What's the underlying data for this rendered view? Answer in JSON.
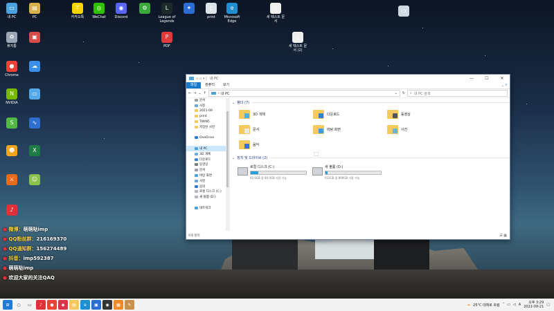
{
  "desktop_icons": [
    {
      "label": "내 PC",
      "color": "#4aa3df",
      "glyph": "▭"
    },
    {
      "label": "PC",
      "color": "#d8b24a",
      "glyph": "▤"
    },
    {
      "label": "카카오톡",
      "color": "#f7d300",
      "glyph": "T"
    },
    {
      "label": "WeChat",
      "color": "#2dc100",
      "glyph": "◎"
    },
    {
      "label": "Discord",
      "color": "#5865f2",
      "glyph": "◉"
    },
    {
      "label": "",
      "color": "#3aa83a",
      "glyph": "⚙"
    },
    {
      "label": "League of Legends",
      "color": "#1b2a2a",
      "glyph": "L"
    },
    {
      "label": "",
      "color": "#2a6ed4",
      "glyph": "✦"
    },
    {
      "label": "print",
      "color": "#dde3ea",
      "glyph": "▯"
    },
    {
      "label": "Microsoft Edge",
      "color": "#1f8fd0",
      "glyph": "e"
    },
    {
      "label": "새 텍스트 문서",
      "color": "#eeeeee",
      "glyph": "▯"
    },
    {
      "label": "",
      "color": "#cfd9e4",
      "glyph": "▭"
    },
    {
      "label": "휴지통",
      "color": "#9aa6b3",
      "glyph": "♻"
    },
    {
      "label": "",
      "color": "#d84b4b",
      "glyph": "▣"
    },
    {
      "label": "PDF",
      "color": "#e23a3a",
      "glyph": "P"
    },
    {
      "label": "새 텍스트 문서 (2)",
      "color": "#eeeeee",
      "glyph": "▯"
    },
    {
      "label": "Chrome",
      "color": "#ea4335",
      "glyph": "●"
    },
    {
      "label": "",
      "color": "#3b8fe6",
      "glyph": "☁"
    },
    {
      "label": "NVIDIA",
      "color": "#76b900",
      "glyph": "N"
    },
    {
      "label": "",
      "color": "#56a9e8",
      "glyph": "▭"
    },
    {
      "label": "",
      "color": "#52b848",
      "glyph": "S"
    },
    {
      "label": "",
      "color": "#2f6fd0",
      "glyph": "∿"
    },
    {
      "label": "",
      "color": "#f2a41c",
      "glyph": "☻"
    },
    {
      "label": "",
      "color": "#1d7b45",
      "glyph": "X"
    },
    {
      "label": "",
      "color": "#e86b1a",
      "glyph": "⚔"
    },
    {
      "label": "",
      "color": "#8bc34a",
      "glyph": "☺"
    },
    {
      "label": "",
      "color": "#e0303a",
      "glyph": "♪"
    }
  ],
  "explorer": {
    "title": "내 PC",
    "window_controls": [
      "—",
      "☐",
      "✕"
    ],
    "ribbon_tabs": [
      "파일",
      "컴퓨터",
      "보기"
    ],
    "address": "내 PC",
    "search_placeholder": "내 PC 검색",
    "nav_items": [
      {
        "label": "문서",
        "color": "#9aa0a6"
      },
      {
        "label": "사진",
        "color": "#6aa6d8"
      },
      {
        "label": "2021-09",
        "color": "#f4c95d"
      },
      {
        "label": "print",
        "color": "#f4c95d"
      },
      {
        "label": "TWIN5",
        "color": "#f4c95d"
      },
      {
        "label": "저장된 사진",
        "color": "#f4c95d"
      },
      {
        "label": "",
        "color": "transparent"
      },
      {
        "label": "OneDrive",
        "color": "#2a7bd4"
      },
      {
        "label": "",
        "color": "transparent"
      },
      {
        "label": "내 PC",
        "color": "#4aa3df",
        "selected": true
      },
      {
        "label": "3D 개체",
        "color": "#6ab0e4"
      },
      {
        "label": "다운로드",
        "color": "#3a86d6"
      },
      {
        "label": "동영상",
        "color": "#7a7a7a"
      },
      {
        "label": "문서",
        "color": "#9aa0a6"
      },
      {
        "label": "바탕 화면",
        "color": "#4aa3df"
      },
      {
        "label": "사진",
        "color": "#6aa6d8"
      },
      {
        "label": "음악",
        "color": "#3a7bd5"
      },
      {
        "label": "로컬 디스크 (C:)",
        "color": "#b0b6bc"
      },
      {
        "label": "새 볼륨 (D:)",
        "color": "#b0b6bc"
      },
      {
        "label": "",
        "color": "transparent"
      },
      {
        "label": "네트워크",
        "color": "#4aa3df"
      }
    ],
    "folders_heading": "폴더 (7)",
    "folders": [
      {
        "label": "3D 개체",
        "badge": "#4ab0e6"
      },
      {
        "label": "다운로드",
        "badge": "#2f7fd6"
      },
      {
        "label": "동영상",
        "badge": "#555555"
      },
      {
        "label": "문서",
        "badge": "#e8e8e8"
      },
      {
        "label": "바탕 화면",
        "badge": "#3a9ee0"
      },
      {
        "label": "사진",
        "badge": "#6fb0e0"
      },
      {
        "label": "음악",
        "badge": "#3a6fd5"
      }
    ],
    "drives_heading": "장치 및 드라이브 (2)",
    "drives": [
      {
        "label": "로컬 디스크 (C:)",
        "fill": 0.14,
        "detail": "93.0GB 중 80.0GB 사용 가능"
      },
      {
        "label": "새 볼륨 (D:)",
        "fill": 0.04,
        "detail": "931GB 중 899GB 사용 가능"
      }
    ],
    "status": "9개 항목"
  },
  "overlay": [
    {
      "key": "微博：",
      "value": "萌萌哒imp"
    },
    {
      "key": "QQ粉丝群：",
      "value": "216169370"
    },
    {
      "key": "QQ通知群：",
      "value": "156274489"
    },
    {
      "key": "抖音：",
      "value": "imp592387"
    },
    {
      "key": "",
      "value": "萌萌哒imp"
    },
    {
      "key": "",
      "value": "欢迎大家的关注QAQ"
    }
  ],
  "taskbar": {
    "weather": "25°C 대체로 흐림",
    "ime": "A",
    "time": "오후 3:29",
    "date": "2021-09-21",
    "icons": [
      {
        "name": "windows-start-icon",
        "color": "#1f7ad8",
        "glyph": "⊞"
      },
      {
        "name": "search-taskbar-icon",
        "color": "#f3f3f3",
        "glyph": "○"
      },
      {
        "name": "task-view-icon",
        "color": "#f3f3f3",
        "glyph": "▭"
      },
      {
        "name": "netease-music-icon",
        "color": "#e0303a",
        "glyph": "♪"
      },
      {
        "name": "chrome-taskbar-icon",
        "color": "#ea4335",
        "glyph": "●"
      },
      {
        "name": "app-taskbar-icon",
        "color": "#d8344a",
        "glyph": "◆"
      },
      {
        "name": "explorer-taskbar-icon",
        "color": "#f4c95d",
        "glyph": "▤"
      },
      {
        "name": "edge-taskbar-icon",
        "color": "#1f8fd0",
        "glyph": "e"
      },
      {
        "name": "store-taskbar-icon",
        "color": "#2a6ed4",
        "glyph": "▣"
      },
      {
        "name": "obs-taskbar-icon",
        "color": "#333333",
        "glyph": "◉"
      },
      {
        "name": "active-app-taskbar-icon",
        "color": "#f08a24",
        "glyph": "▦"
      },
      {
        "name": "pen-taskbar-icon",
        "color": "#c89048",
        "glyph": "✎"
      }
    ]
  }
}
